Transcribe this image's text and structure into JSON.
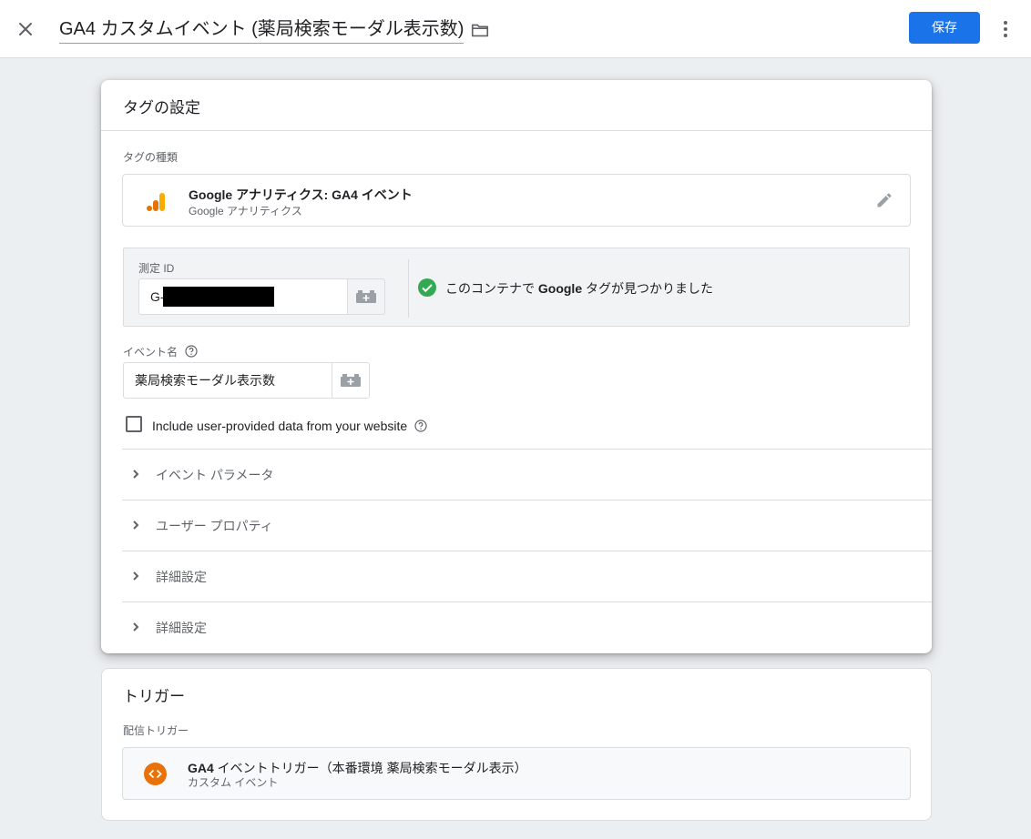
{
  "header": {
    "title": "GA4 カスタムイベント (薬局検索モーダル表示数)",
    "save_label": "保存",
    "accent_color": "#1a73e8"
  },
  "tag_config": {
    "card_title": "タグの設定",
    "tag_type_label": "タグの種類",
    "tag_type_name": "Google アナリティクス: GA4 イベント",
    "tag_type_sub": "Google アナリティクス",
    "measurement_id_label": "測定 ID",
    "measurement_id_value": "G-",
    "tag_found_prefix": "このコンテナで ",
    "tag_found_bold": "Google",
    "tag_found_suffix": " タグが見つかりました",
    "event_name_label": "イベント名",
    "event_name_value": "薬局検索モーダル表示数",
    "checkbox_label": "Include user-provided data from your website",
    "checkbox_checked": false,
    "sections": [
      {
        "label": "イベント パラメータ"
      },
      {
        "label": "ユーザー プロパティ"
      },
      {
        "label": "詳細設定"
      },
      {
        "label": "詳細設定"
      }
    ]
  },
  "trigger": {
    "card_title": "トリガー",
    "firing_label": "配信トリガー",
    "name_bold": "GA4",
    "name_rest": " イベントトリガー（本番環境 薬局検索モーダル表示）",
    "sub": "カスタム イベント",
    "icon_color": "#e8710a"
  },
  "icons": {
    "close": "close-icon",
    "folder": "folder-icon",
    "more": "more-vert-icon",
    "analytics": "google-analytics-icon",
    "edit": "pencil-icon",
    "variable": "variable-brick-icon",
    "check": "check-circle-icon",
    "help": "help-icon",
    "chevron": "chevron-right-icon",
    "trigger": "custom-event-icon"
  }
}
